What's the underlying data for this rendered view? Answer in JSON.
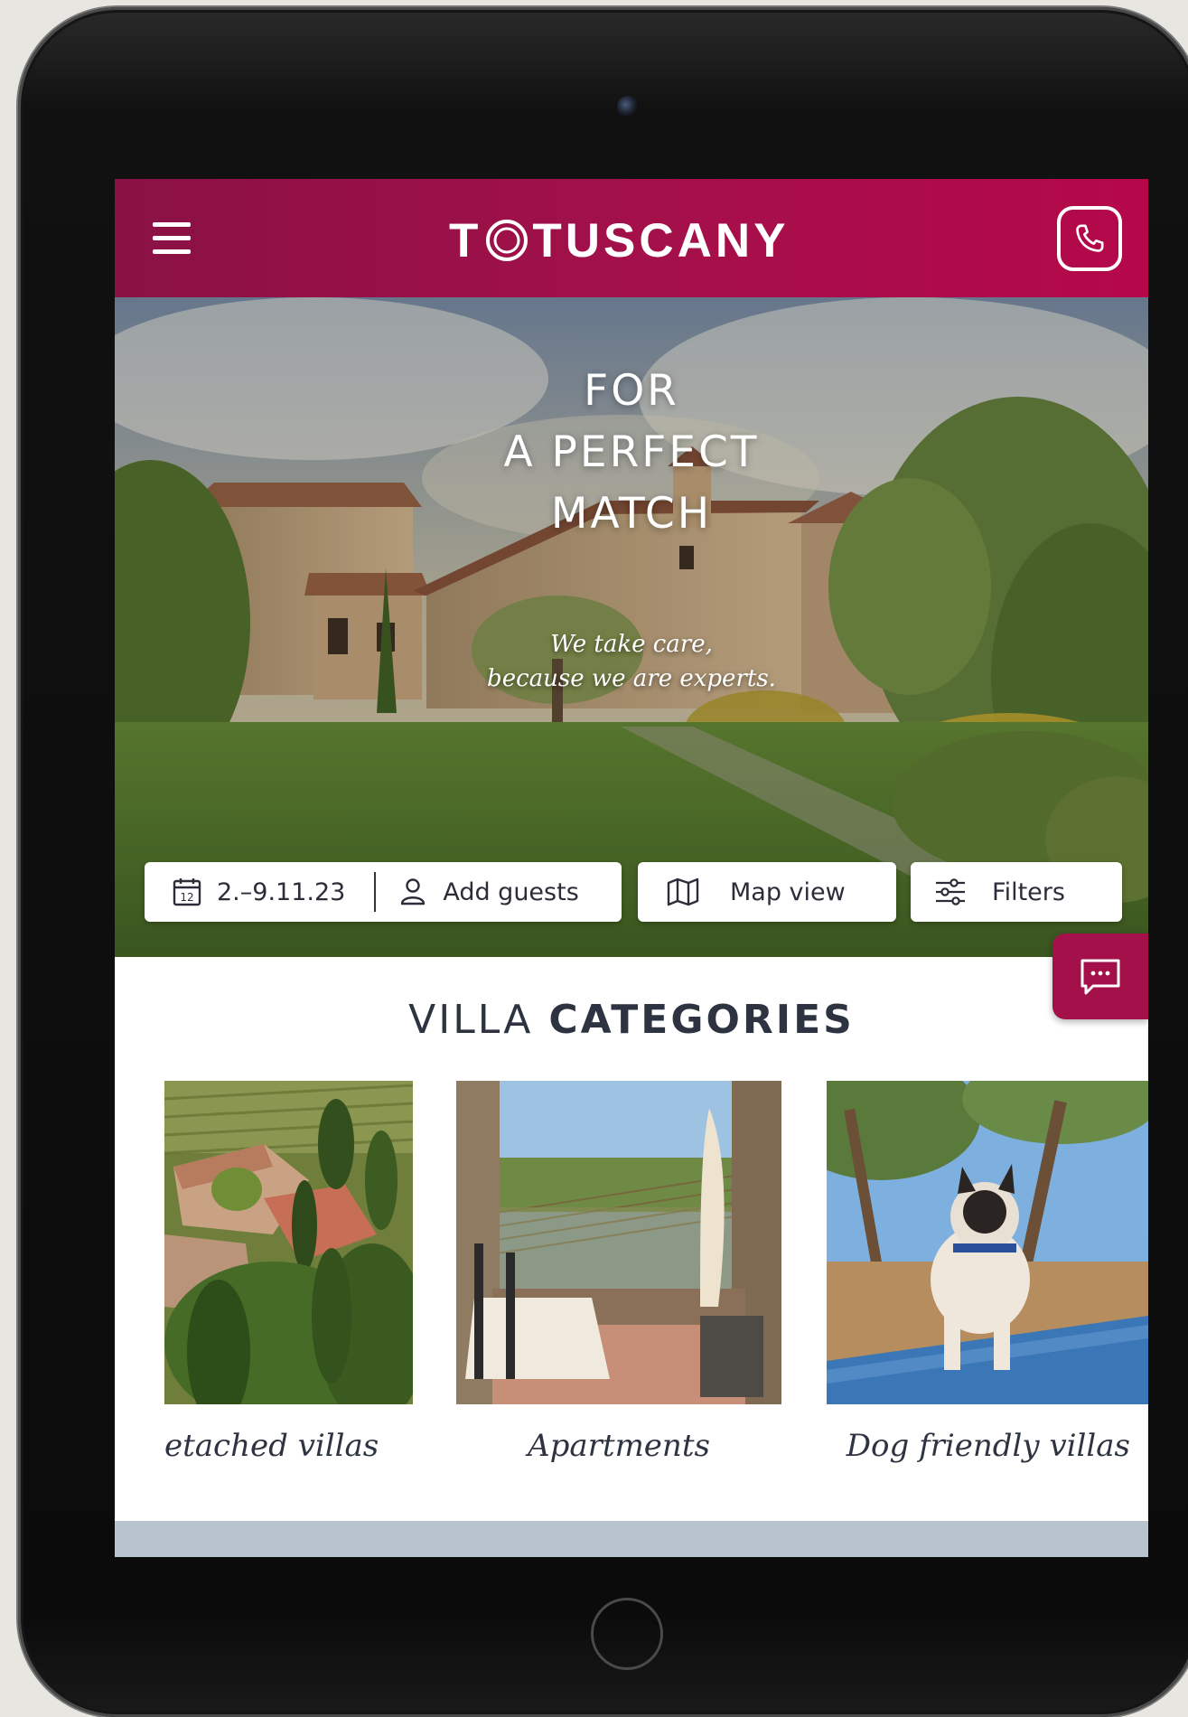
{
  "header": {
    "logo_text_left": "T",
    "logo_text_right": "TUSCANY",
    "menu_icon": "hamburger-menu-icon",
    "phone_icon": "phone-icon"
  },
  "hero": {
    "title_line1": "FOR",
    "title_line2": "A PERFECT",
    "title_line3": "MATCH",
    "subtitle_line1": "We take care,",
    "subtitle_line2": "because we are experts."
  },
  "search": {
    "dates_value": "2.–9.11.23",
    "calendar_day": "12",
    "guests_label": "Add guests",
    "map_label": "Map view",
    "filters_label": "Filters"
  },
  "categories": {
    "title_light": "VILLA",
    "title_bold": "CATEGORIES",
    "items": [
      {
        "label": "etached villas"
      },
      {
        "label": "Apartments"
      },
      {
        "label": "Dog friendly villas"
      }
    ]
  },
  "colors": {
    "brand": "#a3104a",
    "text_dark": "#2d3340",
    "footer_strip": "#b9c3cd"
  }
}
